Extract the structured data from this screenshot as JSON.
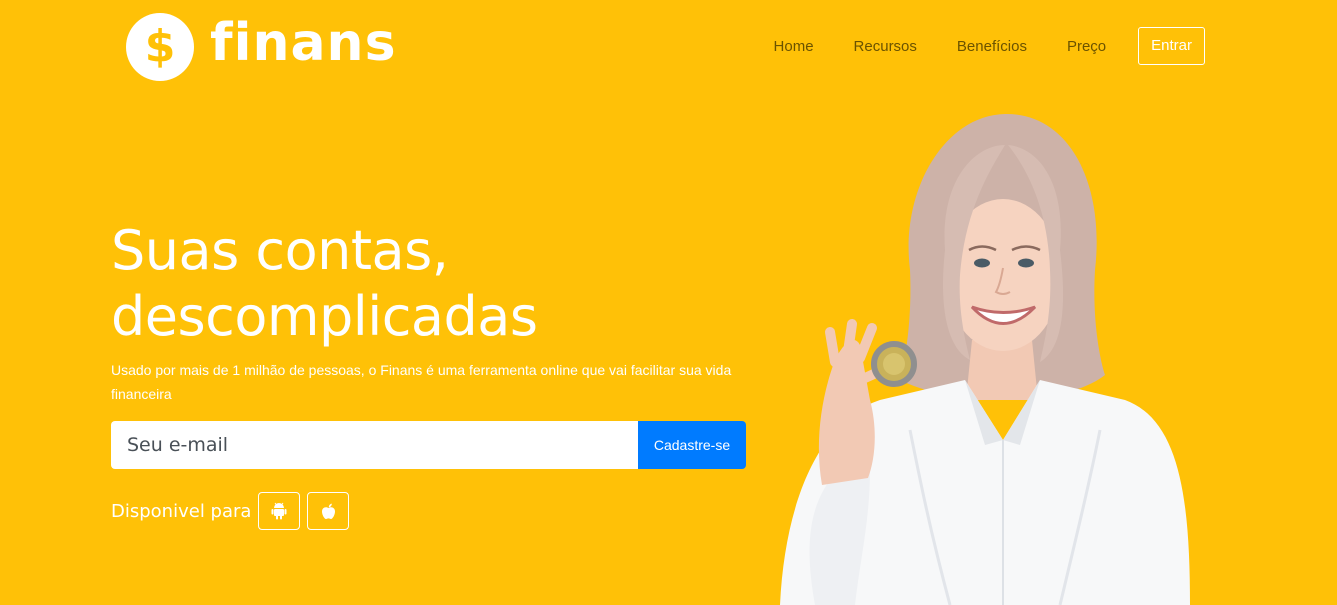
{
  "brand": {
    "logo_symbol": "$",
    "name": "finans",
    "accent_color": "#FFC107",
    "cta_color": "#007BFF"
  },
  "nav": {
    "items": [
      {
        "label": "Home"
      },
      {
        "label": "Recursos"
      },
      {
        "label": "Benefícios"
      },
      {
        "label": "Preço"
      }
    ],
    "login_label": "Entrar"
  },
  "hero": {
    "title_line1": "Suas contas,",
    "title_line2": "descomplicadas",
    "description": "Usado por mais de 1 milhão de pessoas, o Finans é uma ferramenta online que vai facilitar sua vida financeira",
    "email_placeholder": "Seu e-mail",
    "signup_label": "Cadastre-se",
    "available_label": "Disponivel para",
    "store_icons": [
      "android-icon",
      "apple-icon"
    ]
  }
}
